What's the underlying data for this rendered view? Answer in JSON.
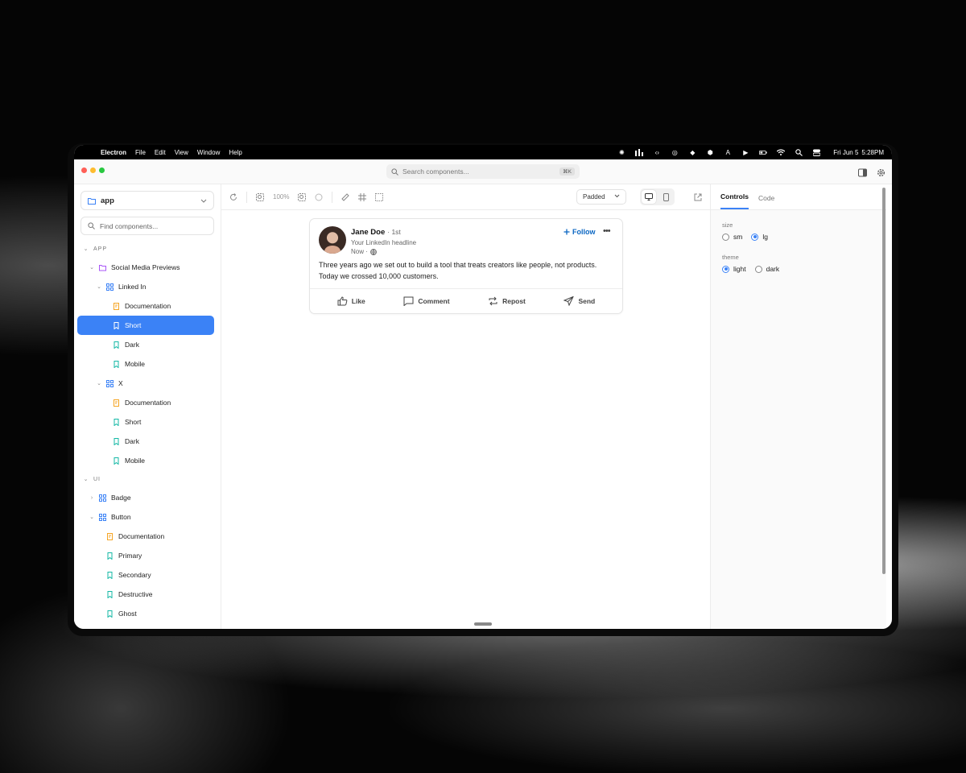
{
  "menubar": {
    "app": "Electron",
    "items": [
      "File",
      "Edit",
      "View",
      "Window",
      "Help"
    ],
    "clock_day": "Fri Jun 5",
    "clock_time": "5:28PM"
  },
  "titlebar": {
    "search_placeholder": "Search components...",
    "search_shortcut": "⌘K"
  },
  "sidebar": {
    "project": "app",
    "find_placeholder": "Find components...",
    "tree": [
      {
        "label": "APP",
        "kind": "section"
      },
      {
        "label": "Social Media Previews",
        "kind": "folder"
      },
      {
        "label": "Linked In",
        "kind": "component"
      },
      {
        "label": "Documentation",
        "kind": "doc"
      },
      {
        "label": "Short",
        "kind": "story",
        "selected": true
      },
      {
        "label": "Dark",
        "kind": "story"
      },
      {
        "label": "Mobile",
        "kind": "story"
      },
      {
        "label": "X",
        "kind": "component"
      },
      {
        "label": "Documentation",
        "kind": "doc"
      },
      {
        "label": "Short",
        "kind": "story"
      },
      {
        "label": "Dark",
        "kind": "story"
      },
      {
        "label": "Mobile",
        "kind": "story"
      },
      {
        "label": "UI",
        "kind": "section"
      },
      {
        "label": "Badge",
        "kind": "component"
      },
      {
        "label": "Button",
        "kind": "component"
      },
      {
        "label": "Documentation",
        "kind": "doc"
      },
      {
        "label": "Primary",
        "kind": "story"
      },
      {
        "label": "Secondary",
        "kind": "story"
      },
      {
        "label": "Destructive",
        "kind": "story"
      },
      {
        "label": "Ghost",
        "kind": "story"
      }
    ]
  },
  "toolbar": {
    "zoom": "100%",
    "layout": "Padded"
  },
  "card": {
    "name": "Jane Doe",
    "degree": "· 1st",
    "headline": "Your LinkedIn headline",
    "time": "Now ·",
    "follow": "Follow",
    "post": "Three years ago we set out to build a tool that treats creators like people, not products. Today we crossed 10,000 customers.",
    "actions": [
      "Like",
      "Comment",
      "Repost",
      "Send"
    ]
  },
  "panel": {
    "tabs": [
      "Controls",
      "Code"
    ],
    "size_label": "size",
    "size_options": [
      "sm",
      "lg"
    ],
    "size_selected": "lg",
    "theme_label": "theme",
    "theme_options": [
      "light",
      "dark"
    ],
    "theme_selected": "light"
  },
  "colors": {
    "accent": "#3b82f6",
    "linkedin_blue": "#0a66c2",
    "doc_icon": "#f5a524",
    "story_icon": "#14b8a6",
    "folder_icon": "#a855f7",
    "component_icon": "#3b82f6"
  }
}
